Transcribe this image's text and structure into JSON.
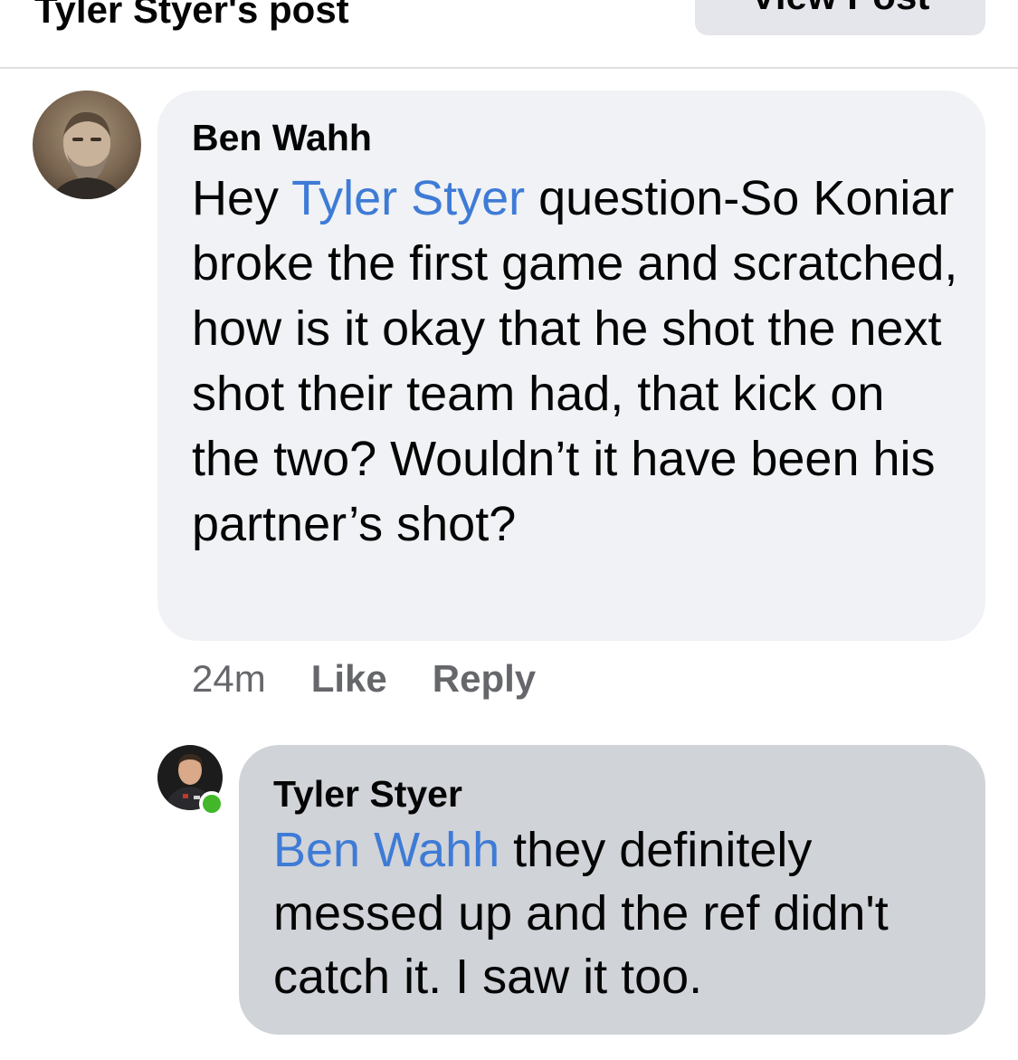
{
  "header": {
    "title": "Tyler Styer's post",
    "view_post_label": "View Post"
  },
  "comments": [
    {
      "author": "Ben Wahh",
      "mention": "Tyler Styer",
      "text_before": "Hey ",
      "text_after": "  question-So Koniar broke the first game and scratched, how is it okay that he shot the next shot their team had, that kick on the two? Wouldn’t it have been his partner’s shot?",
      "time": "24m",
      "like_label": "Like",
      "reply_label": "Reply",
      "bubble_color": "#f0f2f5"
    },
    {
      "author": "Tyler Styer",
      "mention": "Ben Wahh",
      "text_after": " they definitely messed up and the ref didn't catch it. I saw it too.",
      "online": true,
      "bubble_color": "#d0d3d8"
    }
  ],
  "colors": {
    "mention": "#3e7bd6",
    "online_dot": "#42b72a",
    "secondary_text": "#65676b"
  }
}
